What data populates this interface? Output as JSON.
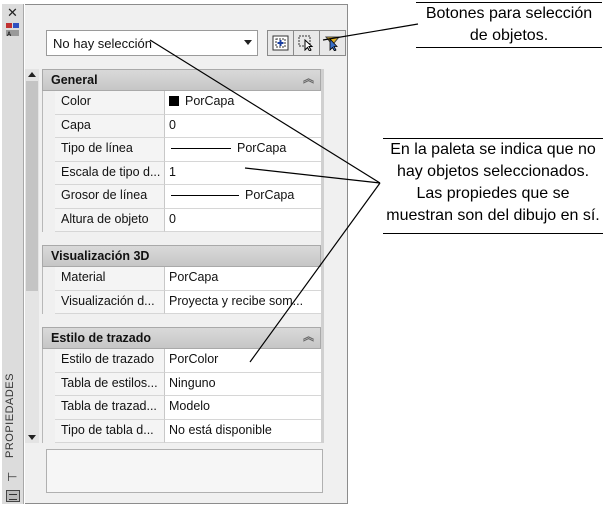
{
  "palette": {
    "title": "PROPIEDADES",
    "selection": {
      "value": "No hay selección"
    },
    "sections": [
      {
        "id": "general",
        "title": "General",
        "rows": [
          {
            "key": "Color",
            "value": "PorCapa",
            "kind": "swatch"
          },
          {
            "key": "Capa",
            "value": "0"
          },
          {
            "key": "Tipo de línea",
            "value": "PorCapa",
            "kind": "linetype"
          },
          {
            "key": "Escala de tipo d...",
            "value": "1"
          },
          {
            "key": "Grosor de línea",
            "value": "PorCapa",
            "kind": "lineweight"
          },
          {
            "key": "Altura de objeto",
            "value": "0"
          }
        ]
      },
      {
        "id": "visual3d",
        "title": "Visualización 3D",
        "rows": [
          {
            "key": "Material",
            "value": "PorCapa"
          },
          {
            "key": "Visualización d...",
            "value": "Proyecta y recibe som..."
          }
        ]
      },
      {
        "id": "plotstyle",
        "title": "Estilo de trazado",
        "rows": [
          {
            "key": "Estilo de trazado",
            "value": "PorColor"
          },
          {
            "key": "Tabla de estilos...",
            "value": "Ninguno"
          },
          {
            "key": "Tabla de trazad...",
            "value": "Modelo"
          },
          {
            "key": "Tipo de tabla d...",
            "value": "No está disponible"
          }
        ]
      }
    ]
  },
  "callouts": {
    "top": "Botones para selección de objetos.",
    "right": "En la paleta se indica que no hay objetos seleccionados. Las propiedes que se muestran son del dibujo en sí."
  },
  "colors": {
    "swatch": "#000000",
    "section_header": "#cfcfcf",
    "palette_bg": "#f0f0f0"
  }
}
